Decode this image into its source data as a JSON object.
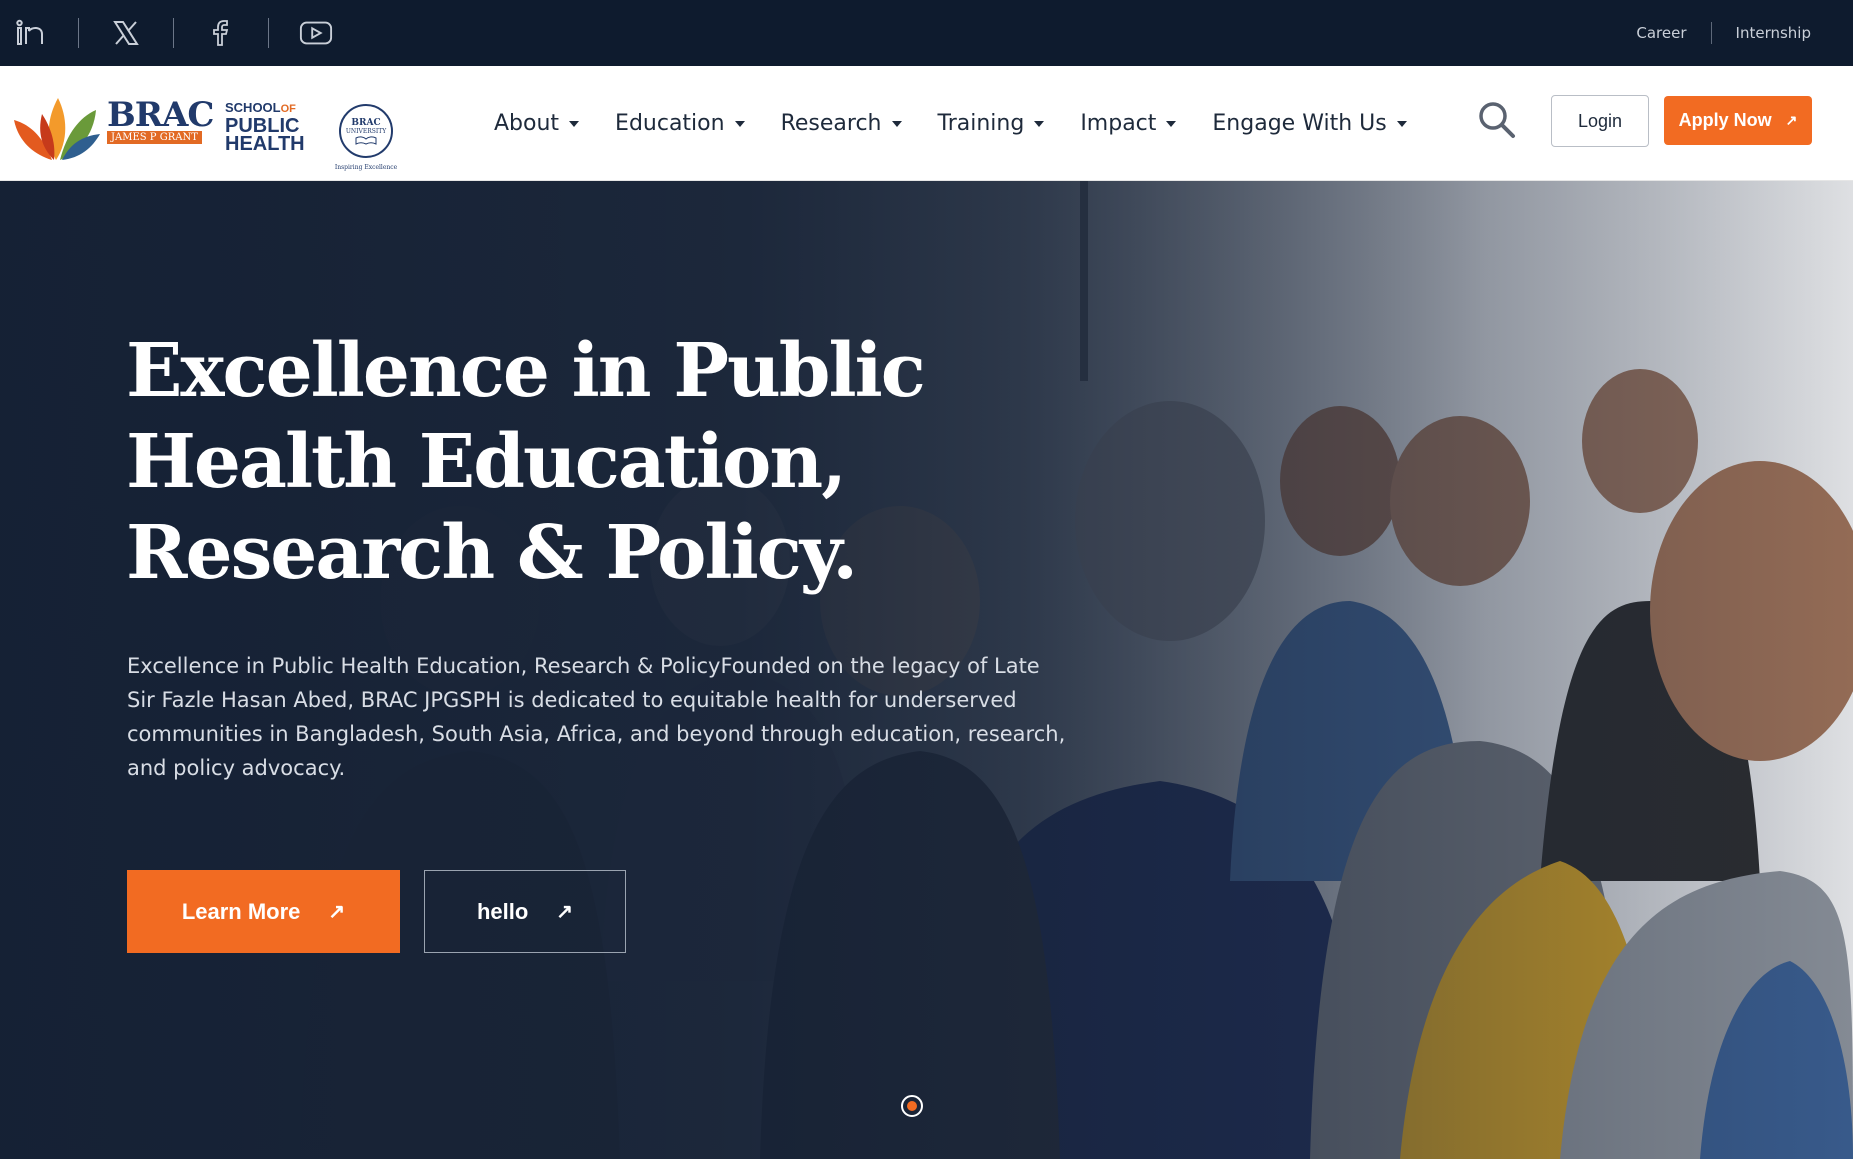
{
  "topbar": {
    "social": [
      {
        "icon": "linkedin-icon"
      },
      {
        "icon": "x-icon"
      },
      {
        "icon": "facebook-icon"
      },
      {
        "icon": "youtube-icon"
      }
    ],
    "links": [
      "Career",
      "Internship"
    ]
  },
  "brand": {
    "brac": "BRAC",
    "school_of": "SCHOOL",
    "of": "OF",
    "public": "PUBLIC",
    "health": "HEALTH",
    "james": "JAMES P GRANT",
    "univ_name": "BRAC",
    "univ_sub": "UNIVERSITY",
    "univ_tag": "Inspiring Excellence"
  },
  "nav": {
    "items": [
      "About",
      "Education",
      "Research",
      "Training",
      "Impact",
      "Engage With Us"
    ],
    "login": "Login",
    "apply": "Apply Now",
    "search_icon": "search-icon"
  },
  "hero": {
    "title": "Excellence in Public Health Education, Research & Policy.",
    "description": "Excellence in Public Health Education, Research & PolicyFounded on the legacy of Late Sir Fazle Hasan Abed, BRAC JPGSPH is dedicated to equitable health for underserved communities in Bangladesh, South Asia, Africa, and beyond through education, research, and policy advocacy.",
    "cta_primary": "Learn More",
    "cta_secondary": "hello",
    "slide_count": 1,
    "active_slide": 1
  },
  "colors": {
    "accent": "#f26b22",
    "topbar_bg": "#0e1b2e",
    "brand_navy": "#213a6b"
  }
}
